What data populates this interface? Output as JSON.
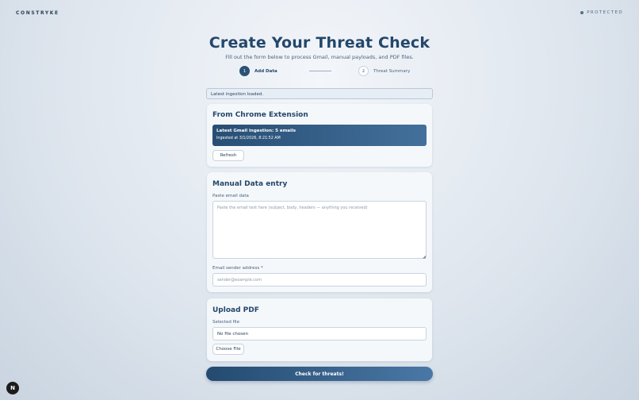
{
  "header": {
    "brand": "CONSTRYKE",
    "status": "PROTECTED"
  },
  "page": {
    "title": "Create Your Threat Check",
    "subtitle": "Fill out the form below to process Gmail, manual payloads, and PDF files."
  },
  "steps": [
    {
      "number": "1",
      "label": "Add Data",
      "active": true
    },
    {
      "number": "2",
      "label": "Threat Summary",
      "active": false
    }
  ],
  "notice": "Latest ingestion loaded.",
  "chrome_extension": {
    "heading": "From Chrome Extension",
    "ingestion_title": "Latest Gmail ingestion: 5 emails",
    "ingestion_time": "Ingested at 3/1/2026, 8:21:52 AM",
    "refresh_label": "Refresh"
  },
  "manual": {
    "heading": "Manual Data entry",
    "email_label": "Paste email data",
    "email_placeholder": "Paste the email text here (subject, body, headers — anything you received)",
    "sender_label": "Email sender address *",
    "sender_placeholder": "sender@example.com"
  },
  "pdf": {
    "heading": "Upload PDF",
    "selected_label": "Selected file",
    "selected_value": "No file chosen",
    "choose_label": "Choose File"
  },
  "submit_label": "Check for threats!",
  "badge": "N",
  "colors": {
    "accent": "#24476a",
    "gradient_start": "#244a70",
    "gradient_end": "#4a78a6"
  }
}
